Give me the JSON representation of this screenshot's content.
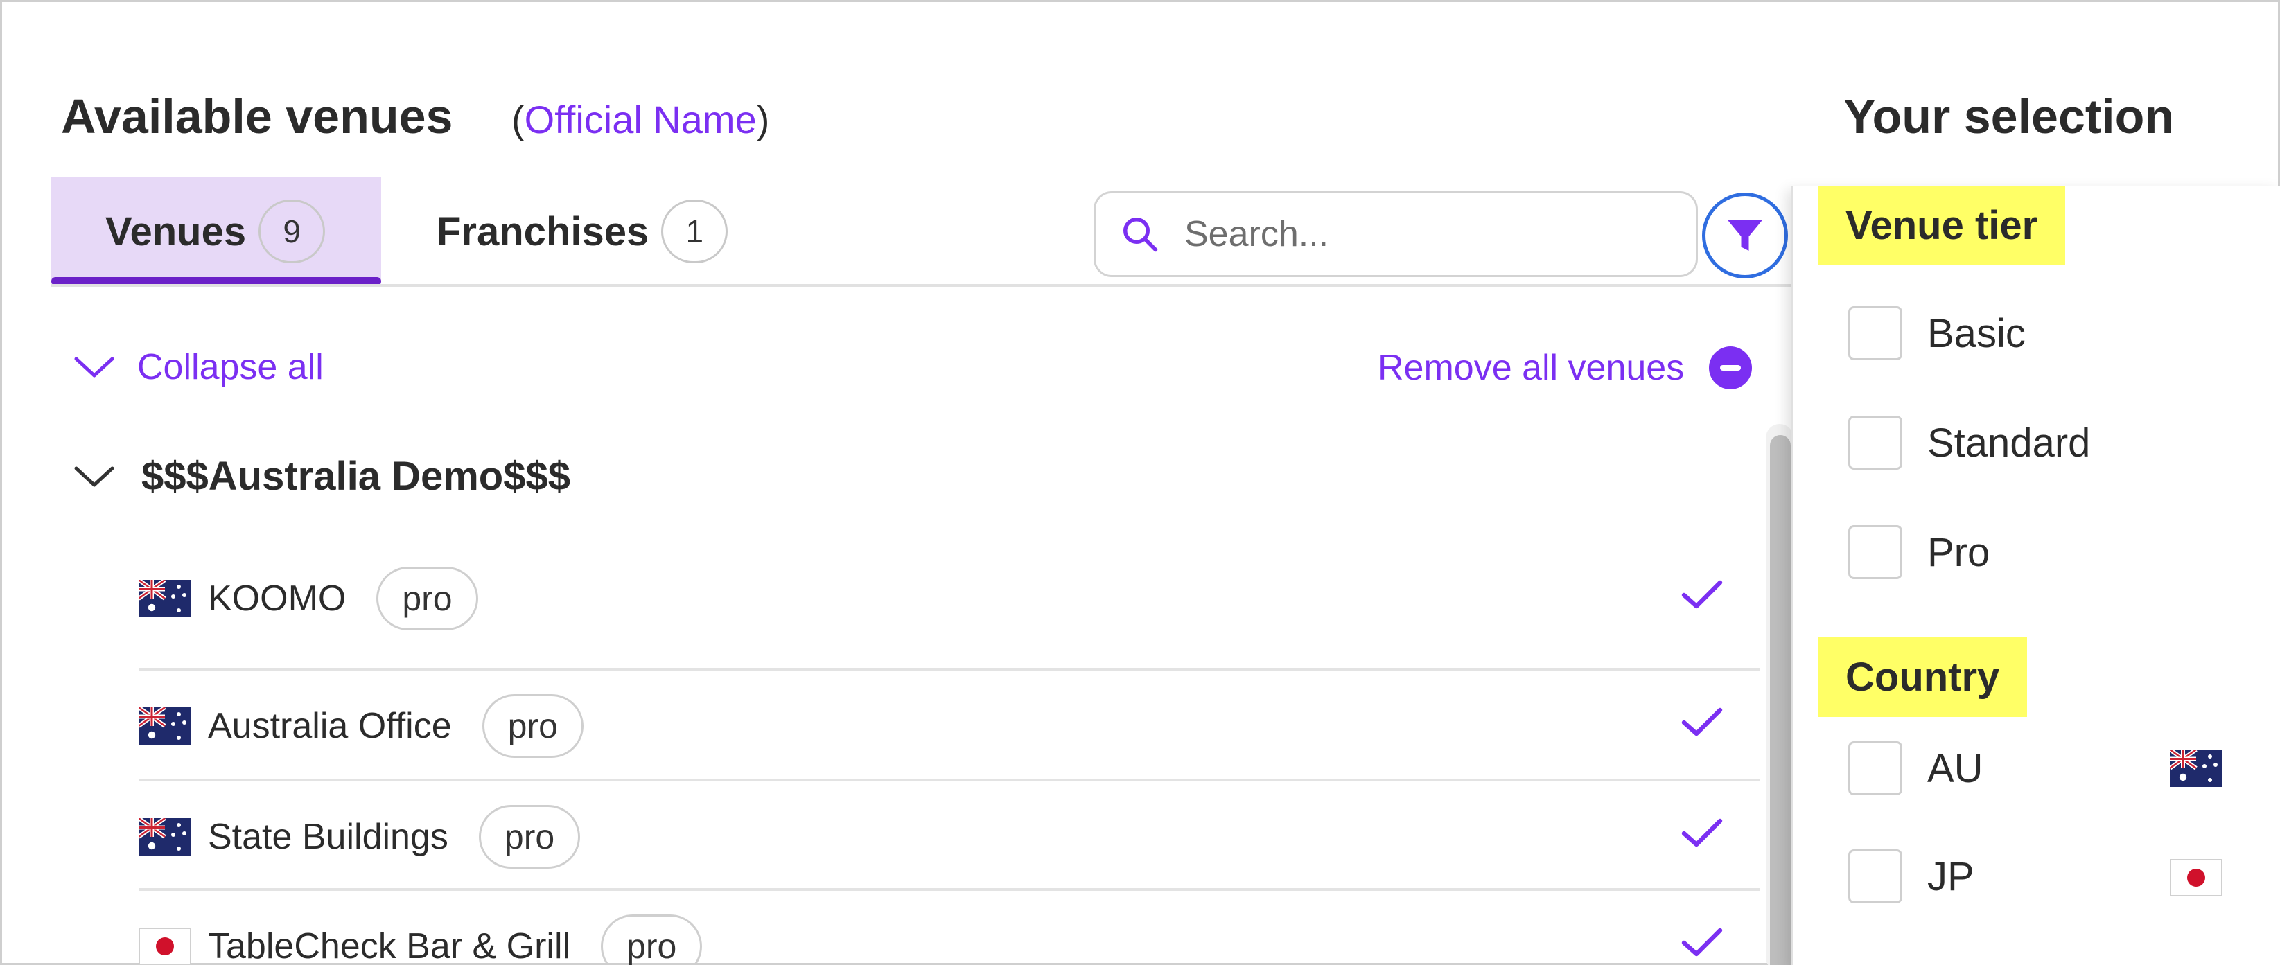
{
  "header": {
    "title": "Available venues",
    "paren_open": "(",
    "subtitle_link": "Official Name",
    "paren_close": ")",
    "selection_title": "Your selection"
  },
  "tabs": [
    {
      "label": "Venues",
      "count": "9",
      "active": true
    },
    {
      "label": "Franchises",
      "count": "1",
      "active": false
    }
  ],
  "search": {
    "placeholder": "Search...",
    "value": ""
  },
  "controls": {
    "collapse_label": "Collapse all",
    "remove_label": "Remove all venues"
  },
  "group": {
    "name": "$$$Australia Demo$$$"
  },
  "venues": [
    {
      "name": "KOOMO",
      "tier": "pro",
      "country": "AU",
      "selected": true
    },
    {
      "name": "Australia Office",
      "tier": "pro",
      "country": "AU",
      "selected": true
    },
    {
      "name": "State Buildings",
      "tier": "pro",
      "country": "AU",
      "selected": true
    },
    {
      "name": "TableCheck Bar & Grill",
      "tier": "pro",
      "country": "JP",
      "selected": true
    }
  ],
  "filter_panel": {
    "tier_heading": "Venue tier",
    "tier_options": [
      "Basic",
      "Standard",
      "Pro"
    ],
    "country_heading": "Country",
    "country_options": [
      "AU",
      "JP"
    ]
  },
  "colors": {
    "accent": "#7b2ff2",
    "tab_active_bg": "#e7d9f7",
    "tab_underline": "#6b21c8",
    "filter_ring": "#2f6de0",
    "highlight": "#ffff66"
  },
  "icons": {
    "search": "search-icon",
    "filter": "filter-icon",
    "chevron": "chevron-down-icon",
    "remove": "minus-circle-icon",
    "check": "check-icon",
    "flag_au": "flag-au-icon",
    "flag_jp": "flag-jp-icon"
  }
}
